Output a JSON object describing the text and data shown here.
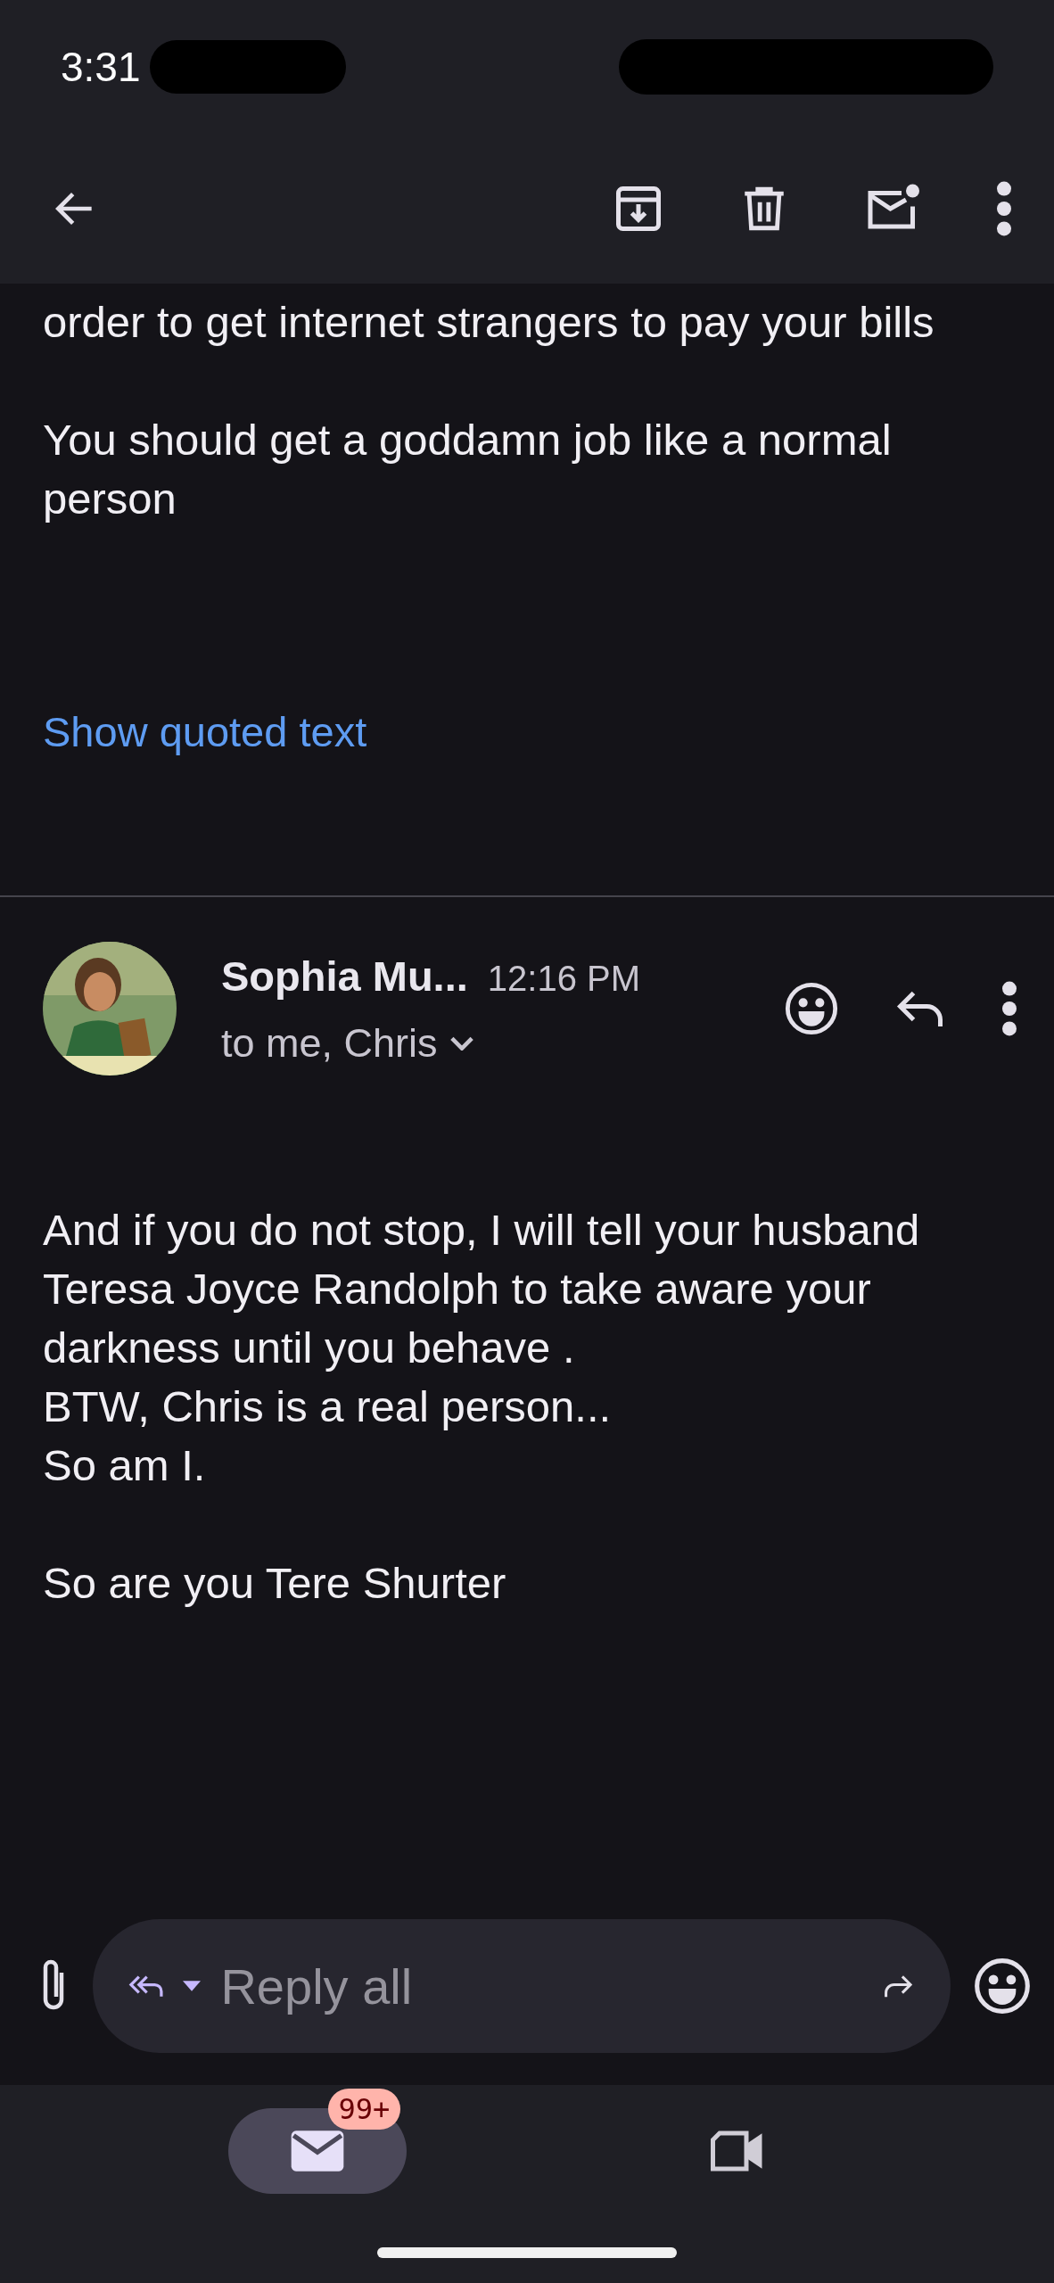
{
  "status_bar": {
    "time": "3:31"
  },
  "earlier_message": {
    "paragraphs": [
      "order to get internet strangers to pay your bills",
      "You should get a goddamn job like a normal person"
    ],
    "show_quoted": "Show quoted text"
  },
  "message": {
    "sender": "Sophia Mu...",
    "time": "12:16 PM",
    "recipients": "to me, Chris",
    "paragraphs": [
      "And if you do not stop, I will tell your husband Teresa Joyce Randolph to take aware your darkness until you behave .\nBTW, Chris is a real person...\nSo am I.",
      "So are you Tere Shurter"
    ]
  },
  "reply_bar": {
    "placeholder": "Reply all"
  },
  "bottom_nav": [
    {
      "kind": "mail",
      "selected": true,
      "badge": "99+"
    },
    {
      "kind": "video",
      "selected": false
    }
  ]
}
